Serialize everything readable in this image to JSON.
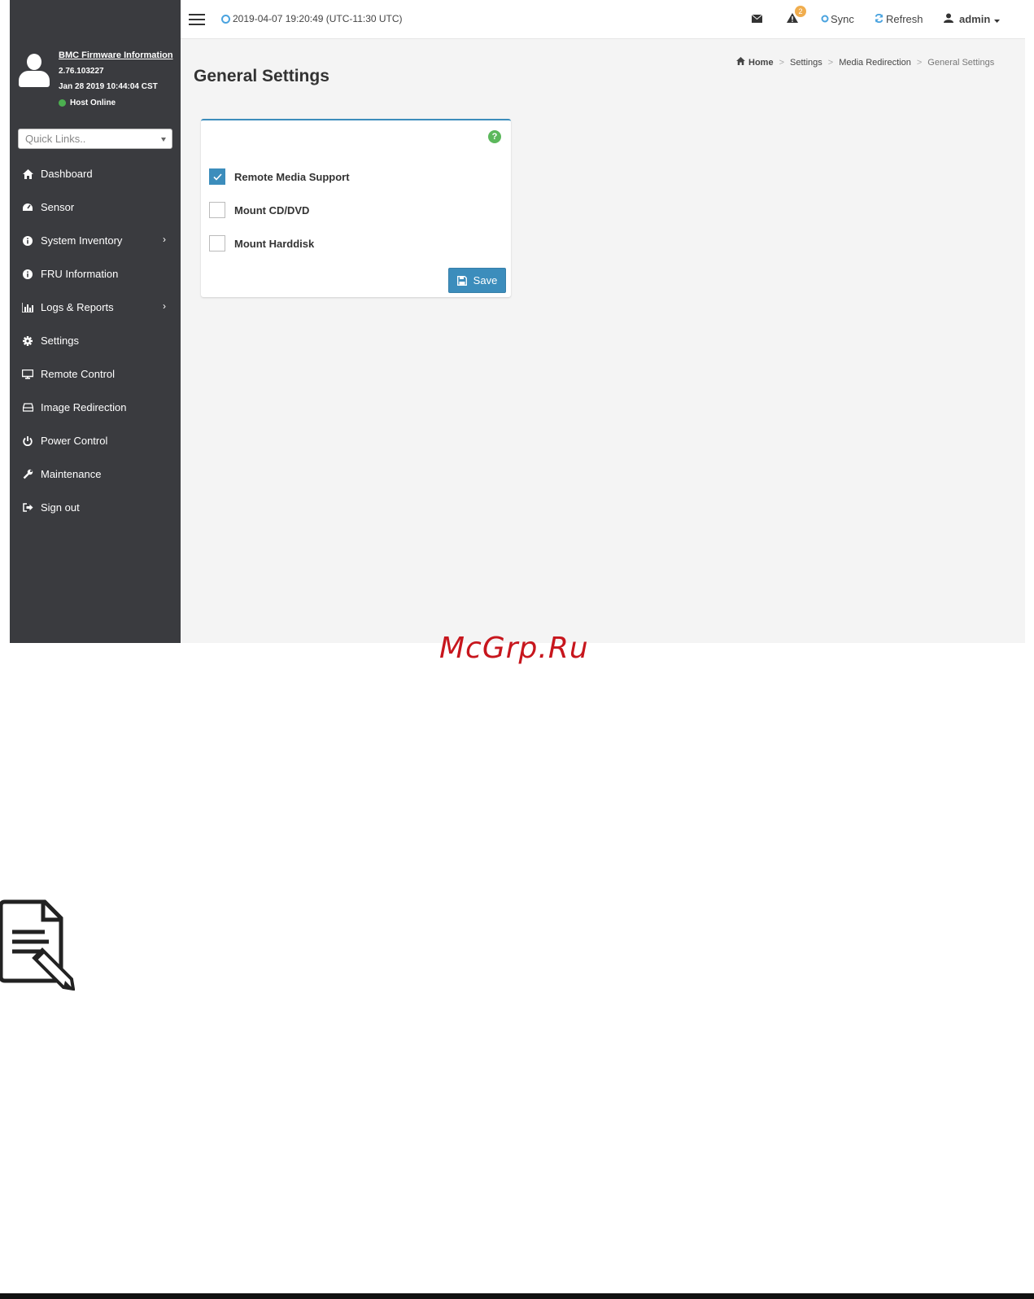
{
  "sidebar": {
    "firmware_title": "BMC Firmware Information",
    "firmware_version": "2.76.103227",
    "firmware_date": "Jan 28 2019 10:44:04 CST",
    "host_status": "Host Online",
    "host_status_color": "#4caf50",
    "quick_links_placeholder": "Quick Links..",
    "items": [
      {
        "label": "Dashboard",
        "icon": "home-icon",
        "has_submenu": false
      },
      {
        "label": "Sensor",
        "icon": "tachometer-icon",
        "has_submenu": false
      },
      {
        "label": "System Inventory",
        "icon": "info-icon",
        "has_submenu": true
      },
      {
        "label": "FRU Information",
        "icon": "info-icon",
        "has_submenu": false
      },
      {
        "label": "Logs & Reports",
        "icon": "bar-chart-icon",
        "has_submenu": true
      },
      {
        "label": "Settings",
        "icon": "gear-icon",
        "has_submenu": false
      },
      {
        "label": "Remote Control",
        "icon": "monitor-icon",
        "has_submenu": false
      },
      {
        "label": "Image Redirection",
        "icon": "hdd-icon",
        "has_submenu": false
      },
      {
        "label": "Power Control",
        "icon": "power-icon",
        "has_submenu": false
      },
      {
        "label": "Maintenance",
        "icon": "wrench-icon",
        "has_submenu": false
      },
      {
        "label": "Sign out",
        "icon": "sign-out-icon",
        "has_submenu": false
      }
    ]
  },
  "topbar": {
    "datetime": "2019-04-07 19:20:49 (UTC-11:30 UTC)",
    "alert_count": "2",
    "sync_label": "Sync",
    "refresh_label": "Refresh",
    "user_label": "admin"
  },
  "page": {
    "title": "General Settings",
    "breadcrumb": [
      "Home",
      "Settings",
      "Media Redirection",
      "General Settings"
    ]
  },
  "form": {
    "options": [
      {
        "label": "Remote Media Support",
        "checked": true
      },
      {
        "label": "Mount CD/DVD",
        "checked": false
      },
      {
        "label": "Mount Harddisk",
        "checked": false
      }
    ],
    "save_label": "Save"
  },
  "colors": {
    "sidebar_bg": "#3a3b3f",
    "accent": "#3c8dbc",
    "help": "#5cb85c",
    "badge": "#f0ad4e"
  },
  "watermark": "McGrp.Ru"
}
